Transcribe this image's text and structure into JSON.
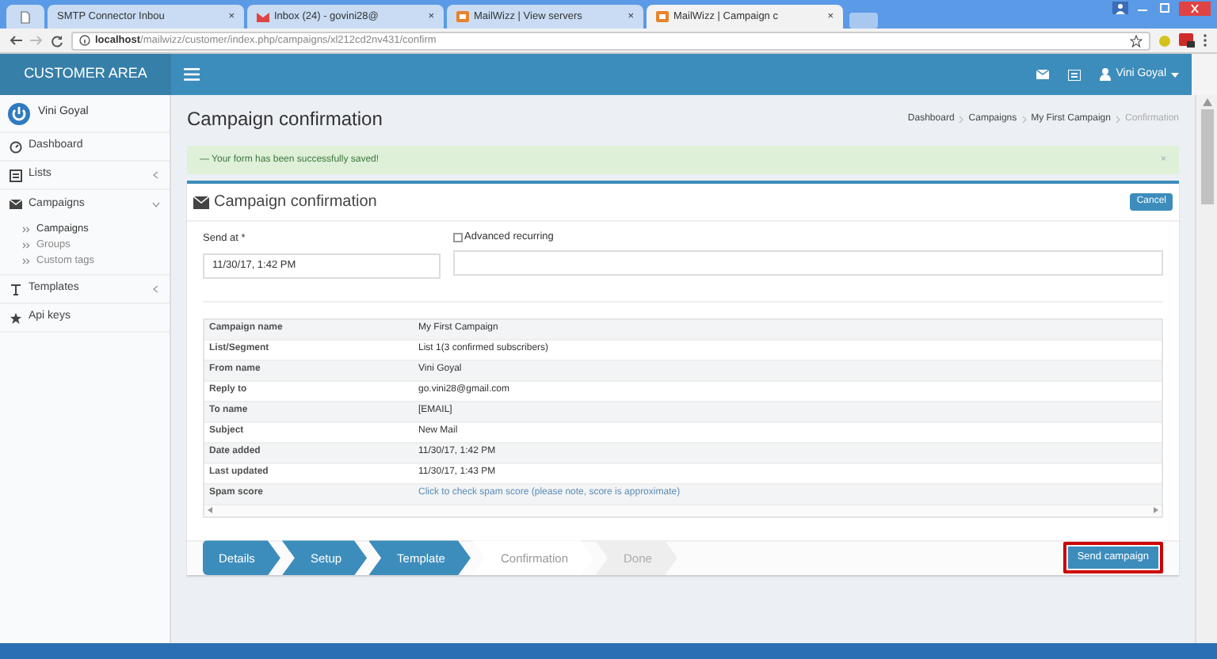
{
  "browser": {
    "tabs": [
      {
        "title": "SMTP Connector Inbou",
        "kind": "mail",
        "close": "×",
        "selected": false
      },
      {
        "title": "Inbox (24) - govini28@",
        "kind": "webmail",
        "close": "×",
        "selected": false
      },
      {
        "title": "MailWizz | View servers",
        "kind": "site",
        "close": "×",
        "selected": false
      },
      {
        "title": "MailWizz | Campaign c",
        "kind": "site",
        "close": "×",
        "selected": true
      }
    ],
    "url_host": "localhost",
    "url_path": "/mailwizz/customer/index.php/campaigns/xl212cd2nv431/confirm"
  },
  "header": {
    "brand": "CUSTOMER AREA",
    "user": "Vini Goyal"
  },
  "sidebar": {
    "user": "Vini Goyal",
    "items": [
      {
        "label": "Dashboard",
        "kind": "dashboard"
      },
      {
        "label": "Lists",
        "kind": "list",
        "expanded": false
      },
      {
        "label": "Campaigns",
        "kind": "envelope",
        "expanded": true,
        "children": [
          {
            "label": "Campaigns",
            "selected": true
          },
          {
            "label": "Groups",
            "selected": false
          },
          {
            "label": "Custom tags",
            "selected": false
          }
        ]
      },
      {
        "label": "Templates",
        "kind": "text",
        "expanded": false
      },
      {
        "label": "Api keys",
        "kind": "star"
      }
    ]
  },
  "page": {
    "title": "Campaign confirmation",
    "breadcrumbs": [
      {
        "label": "Dashboard",
        "selected": false
      },
      {
        "label": "Campaigns",
        "selected": false
      },
      {
        "label": "My First Campaign",
        "selected": false
      },
      {
        "label": "Confirmation",
        "selected": true
      }
    ],
    "alert": {
      "text": "— Your form has been successfully saved!",
      "close": "×"
    },
    "box": {
      "title": "Campaign confirmation",
      "cancel": "Cancel",
      "send_at": {
        "label": "Send at *",
        "value": "11/30/17, 1:42 PM"
      },
      "advanced_recurring": {
        "label": "Advanced recurring",
        "checked": false
      },
      "details": [
        {
          "label": "Campaign name",
          "value": "My First Campaign",
          "kind": "text"
        },
        {
          "label": "List/Segment",
          "value": "List 1(3 confirmed subscribers)",
          "kind": "text"
        },
        {
          "label": "From name",
          "value": "Vini Goyal",
          "kind": "text"
        },
        {
          "label": "Reply to",
          "value": "go.vini28@gmail.com",
          "kind": "text"
        },
        {
          "label": "To name",
          "value": "[EMAIL]",
          "kind": "text"
        },
        {
          "label": "Subject",
          "value": "New Mail",
          "kind": "text"
        },
        {
          "label": "Date added",
          "value": "11/30/17, 1:42 PM",
          "kind": "text"
        },
        {
          "label": "Last updated",
          "value": "11/30/17, 1:43 PM",
          "kind": "text"
        },
        {
          "label": "Spam score",
          "value": "Click to check spam score (please note, score is approximate)",
          "kind": "link"
        }
      ]
    },
    "wizard": [
      {
        "label": "Details",
        "completed": true,
        "selected": false
      },
      {
        "label": "Setup",
        "completed": true,
        "selected": false
      },
      {
        "label": "Template",
        "completed": true,
        "selected": false
      },
      {
        "label": "Confirmation",
        "completed": false,
        "selected": true
      },
      {
        "label": "Done",
        "completed": false,
        "selected": false
      }
    ],
    "send": "Send campaign"
  }
}
